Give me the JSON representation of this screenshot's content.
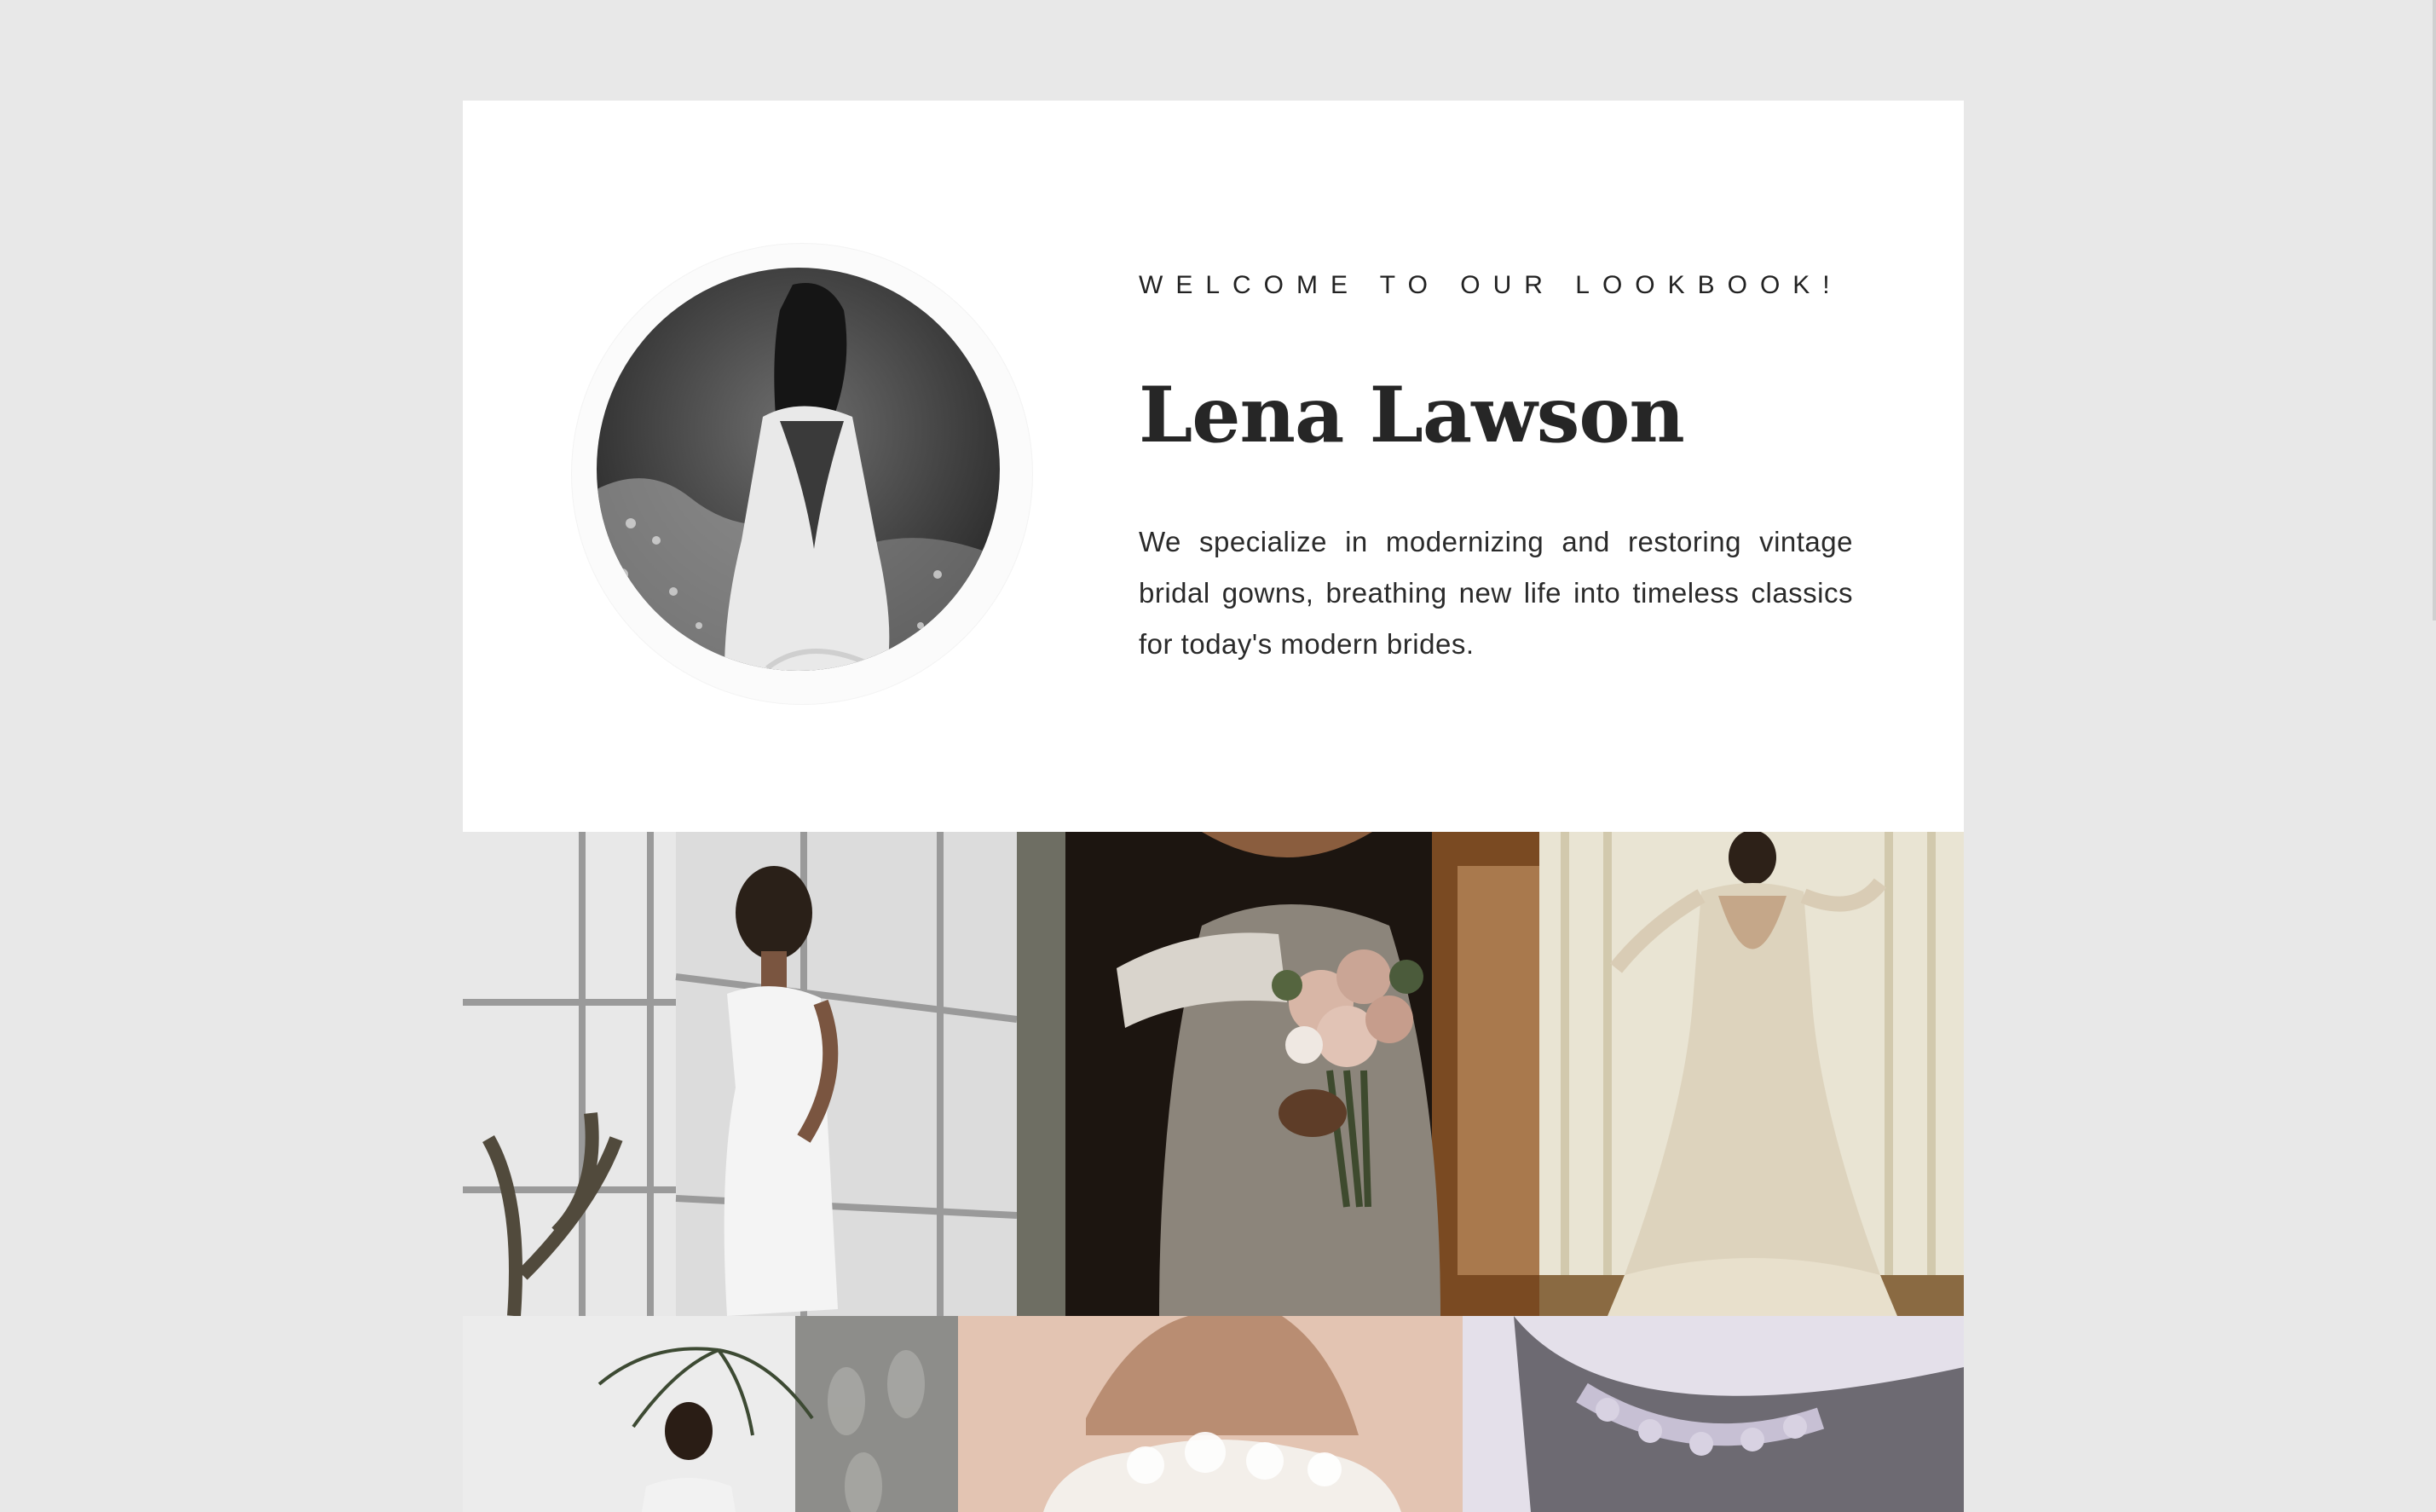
{
  "lookbook": {
    "eyebrow": "WELCOME TO OUR LOOKBOOK!",
    "name": "Lena Lawson",
    "bio": "We specialize in modernizing and restoring vintage bridal gowns, breathing new life into timeless classics for today's modern brides."
  },
  "gallery": {
    "photos": [
      {
        "subject": "bride in fitted gown by tall window with cactus"
      },
      {
        "subject": "off-shoulder lace gown holding rose bouquet"
      },
      {
        "subject": "open-back lace mermaid gown at curtained window"
      },
      {
        "subject": "bride beside palm fronds and grey wall"
      },
      {
        "subject": "off-shoulder ruffled gown on blush background"
      },
      {
        "subject": "lace appliqué detail on shoulder"
      }
    ]
  },
  "colors": {
    "background": "#e8e8e8",
    "card": "#ffffff",
    "text": "#262626"
  }
}
